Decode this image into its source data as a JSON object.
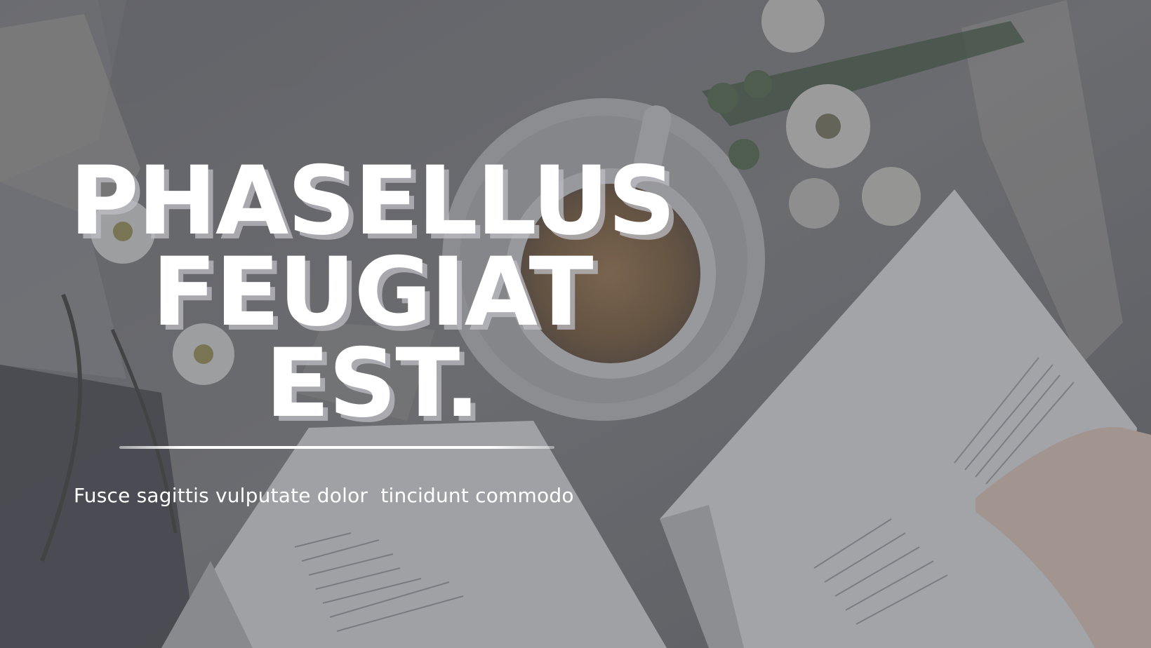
{
  "hero": {
    "title_lines": [
      "PHASELLUS",
      "FEUGIAT",
      "EST."
    ],
    "subtitle": "Fusce sagittis vulputate dolor  tincidunt commodo"
  },
  "background": {
    "description_icon": "tea-and-books-photo-icon",
    "overlay_color": "#5f6066"
  }
}
